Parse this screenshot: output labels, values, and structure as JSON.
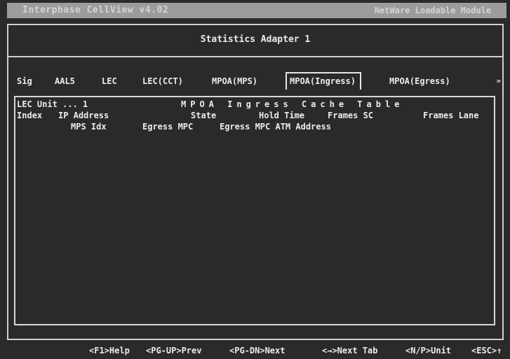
{
  "app": {
    "title": "Interphase CellView  v4.02",
    "module_label": "NetWare Loadable Module"
  },
  "window": {
    "title": "Statistics Adapter 1"
  },
  "tabs": [
    {
      "label": "Sig",
      "active": false
    },
    {
      "label": "AAL5",
      "active": false
    },
    {
      "label": "LEC",
      "active": false
    },
    {
      "label": "LEC(CCT)",
      "active": false
    },
    {
      "label": "MPOA(MPS)",
      "active": false
    },
    {
      "label": "MPOA(Ingress)",
      "active": true
    },
    {
      "label": "MPOA(Egress)",
      "active": false
    }
  ],
  "tab_scroll_indicator": "»",
  "content": {
    "unit_label": "LEC Unit ... 1",
    "table_title": "MPOA Ingress Cache Table",
    "columns_row1": [
      "Index",
      "IP Address",
      "State",
      "Hold Time",
      "Frames SC",
      "Frames Lane"
    ],
    "columns_row2": [
      "MPS Idx",
      "Egress MPC",
      "Egress MPC ATM Address"
    ],
    "rows": []
  },
  "footer_keys": [
    "<F1>Help",
    "<PG-UP>Prev",
    "<PG-DN>Next",
    "<→>Next Tab",
    "<N/P>Unit",
    "<ESC>↑"
  ]
}
